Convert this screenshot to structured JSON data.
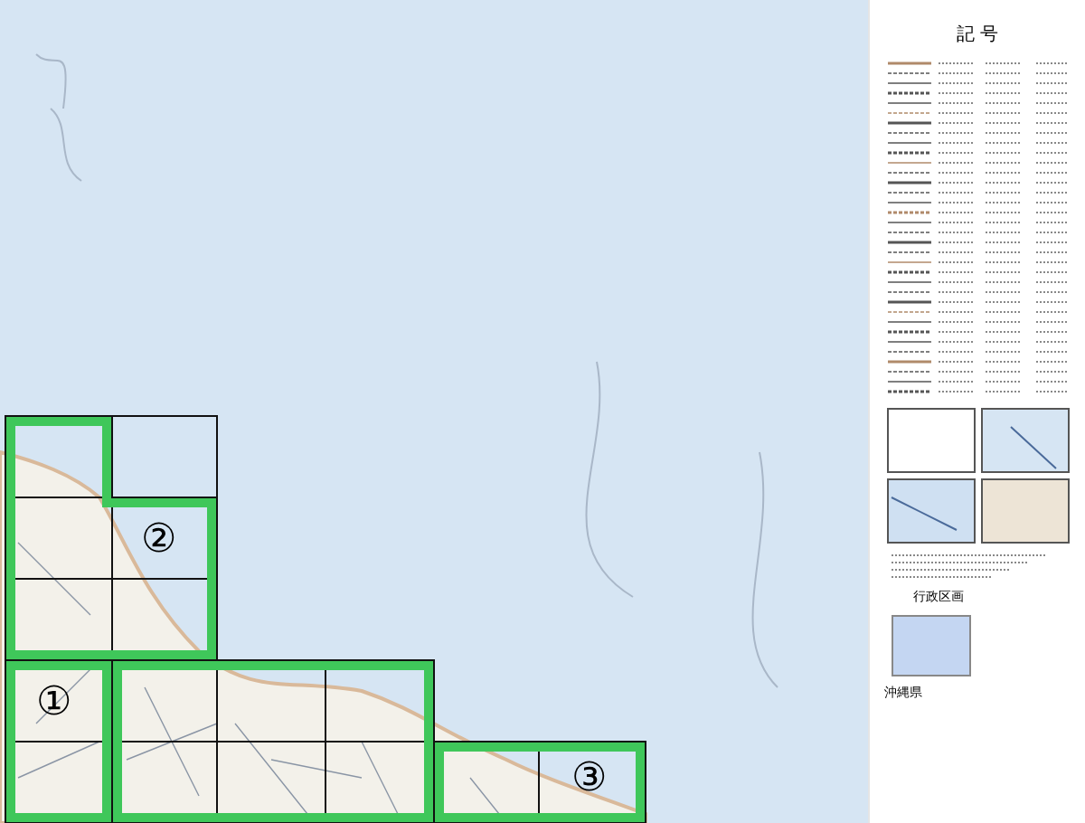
{
  "map": {
    "areas": [
      {
        "label": "①"
      },
      {
        "label": "②"
      },
      {
        "label": "③"
      }
    ]
  },
  "legend": {
    "title": "記 号",
    "admin_heading": "行政区画",
    "prefecture": "沖縄県"
  }
}
